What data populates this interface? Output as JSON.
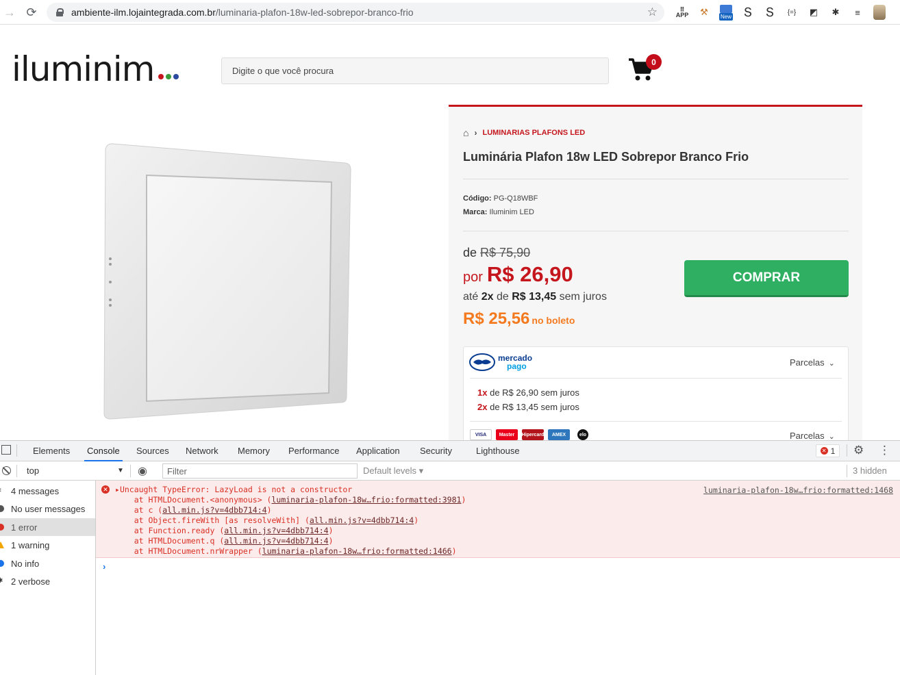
{
  "browser": {
    "url_host": "ambiente-ilm.lojaintegrada.com.br",
    "url_path": "/luminaria-plafon-18w-led-sobrepor-branco-frio",
    "ext_new_label": "New",
    "ext_app_label": "APP"
  },
  "site": {
    "logo_text": "iluminim",
    "logo_dot_colors": [
      "#c4161c",
      "#3a9b3a",
      "#2b4aa0"
    ],
    "search_placeholder": "Digite o que você procura",
    "cart_count": "0"
  },
  "product": {
    "breadcrumb_category": "LUMINARIAS PLAFONS LED",
    "title": "Luminária Plafon 18w LED Sobrepor Branco Frio",
    "code_label": "Código:",
    "code_value": "PG-Q18WBF",
    "brand_label": "Marca:",
    "brand_value": "Iluminim LED",
    "price_de_label": "de",
    "price_old": "R$ 75,90",
    "price_por_label": "por",
    "price_new": "R$ 26,90",
    "installment_prefix": "até",
    "installment_count": "2x",
    "installment_mid": "de",
    "installment_value": "R$ 13,45",
    "installment_suffix": "sem juros",
    "boleto_price": "R$ 25,56",
    "boleto_label": "no boleto",
    "buy_button": "COMPRAR",
    "accent_color": "#c4161c",
    "buy_color": "#2eaf62",
    "boleto_color": "#f47a20"
  },
  "payment": {
    "mp_brand_line1": "mercado",
    "mp_brand_line2": "pago",
    "parcelas_label": "Parcelas",
    "lines": [
      {
        "x": "1x",
        "text": "de R$ 26,90 sem juros"
      },
      {
        "x": "2x",
        "text": "de R$ 13,45 sem juros"
      }
    ],
    "parcelas_label_2": "Parcelas",
    "cards": [
      "VISA",
      "Master",
      "Hipercard",
      "AMEX",
      "elo"
    ]
  },
  "devtools": {
    "tabs": [
      "Elements",
      "Console",
      "Sources",
      "Network",
      "Memory",
      "Performance",
      "Application",
      "Security",
      "Lighthouse"
    ],
    "active_tab": "Console",
    "error_count": "1",
    "context": "top",
    "filter_placeholder": "Filter",
    "levels": "Default levels",
    "hidden": "3 hidden",
    "sidebar": [
      {
        "label": "4 messages",
        "icon": "list-icon"
      },
      {
        "label": "No user messages",
        "icon": "user-icon"
      },
      {
        "label": "1 error",
        "icon": "error-icon"
      },
      {
        "label": "1 warning",
        "icon": "warning-icon"
      },
      {
        "label": "No info",
        "icon": "info-icon"
      },
      {
        "label": "2 verbose",
        "icon": "bug-icon"
      }
    ],
    "error": {
      "message": "Uncaught TypeError: LazyLoad is not a constructor",
      "source": "luminaria-plafon-18w…frio:formatted:1468",
      "stack": [
        {
          "pre": "    at HTMLDocument.<anonymous> (",
          "link": "luminaria-plafon-18w…frio:formatted:3981",
          "post": ")"
        },
        {
          "pre": "    at c (",
          "link": "all.min.js?v=4dbb714:4",
          "post": ")"
        },
        {
          "pre": "    at Object.fireWith [as resolveWith] (",
          "link": "all.min.js?v=4dbb714:4",
          "post": ")"
        },
        {
          "pre": "    at Function.ready (",
          "link": "all.min.js?v=4dbb714:4",
          "post": ")"
        },
        {
          "pre": "    at HTMLDocument.q (",
          "link": "all.min.js?v=4dbb714:4",
          "post": ")"
        },
        {
          "pre": "    at HTMLDocument.nrWrapper (",
          "link": "luminaria-plafon-18w…frio:formatted:1466",
          "post": ")"
        }
      ]
    }
  }
}
